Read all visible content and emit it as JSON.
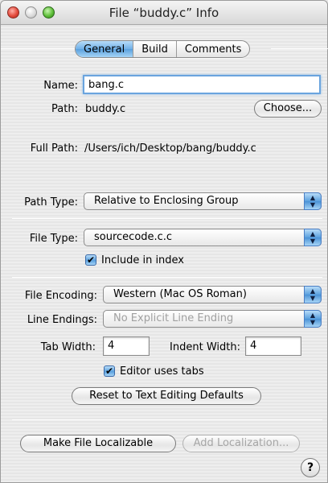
{
  "window": {
    "title": "File “buddy.c” Info"
  },
  "tabs": [
    {
      "label": "General",
      "active": true
    },
    {
      "label": "Build",
      "active": false
    },
    {
      "label": "Comments",
      "active": false
    }
  ],
  "general": {
    "name_label": "Name:",
    "name_value": "bang.c",
    "path_label": "Path:",
    "path_value": "buddy.c",
    "choose_button": "Choose...",
    "full_path_label": "Full Path:",
    "full_path_value": "/Users/ich/Desktop/bang/buddy.c",
    "path_type_label": "Path Type:",
    "path_type_value": "Relative to Enclosing Group",
    "file_type_label": "File Type:",
    "file_type_value": "sourcecode.c.c",
    "include_in_index_label": "Include in index",
    "include_in_index_checked": true,
    "file_encoding_label": "File Encoding:",
    "file_encoding_value": "Western (Mac OS Roman)",
    "line_endings_label": "Line Endings:",
    "line_endings_value": "No Explicit Line Ending",
    "tab_width_label": "Tab Width:",
    "tab_width_value": "4",
    "indent_width_label": "Indent Width:",
    "indent_width_value": "4",
    "editor_uses_tabs_label": "Editor uses tabs",
    "editor_uses_tabs_checked": true,
    "reset_button": "Reset to Text Editing Defaults",
    "make_localizable_button": "Make File Localizable",
    "add_localization_button": "Add Localization...",
    "help_button": "?"
  },
  "colors": {
    "accent": "#5aa0de",
    "disabled_text": "#a0a0a0"
  }
}
